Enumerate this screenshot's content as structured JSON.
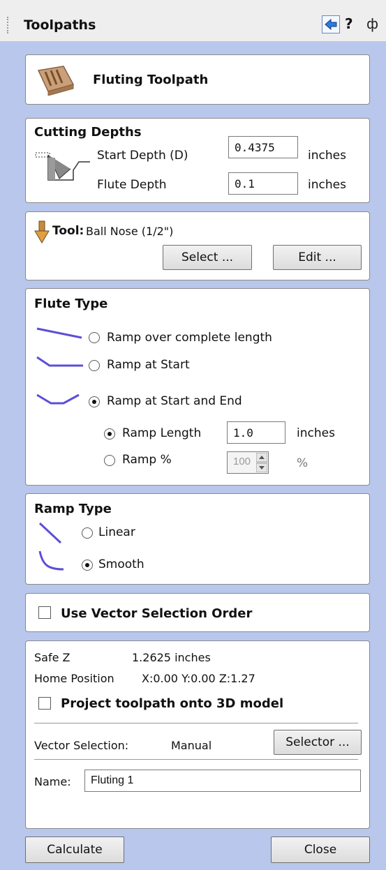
{
  "panel": {
    "title": "Toolpaths",
    "help": "?",
    "dock": "ф"
  },
  "header": {
    "title": "Fluting Toolpath",
    "icon": "fluting-tool-icon"
  },
  "cutting_depths": {
    "title": "Cutting Depths",
    "start_label": "Start Depth (D)",
    "start_value": "0.4375",
    "start_unit": "inches",
    "flute_label": "Flute Depth",
    "flute_value": "0.1",
    "flute_unit": "inches"
  },
  "tool": {
    "label": "Tool:",
    "name": "Ball Nose (1/2\")",
    "select_btn": "Select ...",
    "edit_btn": "Edit ..."
  },
  "flute_type": {
    "title": "Flute Type",
    "options": [
      "Ramp over complete length",
      "Ramp at Start",
      "Ramp at Start and End"
    ],
    "selected": 2,
    "ramp_length_label": "Ramp Length",
    "ramp_length_value": "1.0",
    "ramp_length_unit": "inches",
    "ramp_pct_label": "Ramp %",
    "ramp_pct_value": "100",
    "ramp_pct_unit": "%"
  },
  "ramp_type": {
    "title": "Ramp Type",
    "options": [
      "Linear",
      "Smooth"
    ],
    "selected": 1
  },
  "vector_order": {
    "label": "Use Vector Selection Order",
    "checked": false
  },
  "settings": {
    "safe_z_label": "Safe Z",
    "safe_z_value": "1.2625 inches",
    "home_label": "Home Position",
    "home_value": "X:0.00 Y:0.00 Z:1.27",
    "project_label": "Project toolpath onto 3D model",
    "project_checked": false,
    "vector_sel_label": "Vector Selection:",
    "vector_sel_value": "Manual",
    "selector_btn": "Selector ...",
    "name_label": "Name:",
    "name_value": "Fluting 1"
  },
  "footer": {
    "calculate": "Calculate",
    "close": "Close"
  },
  "colors": {
    "panel_bg": "#b9c7ec",
    "accent": "#5b4fd6"
  }
}
